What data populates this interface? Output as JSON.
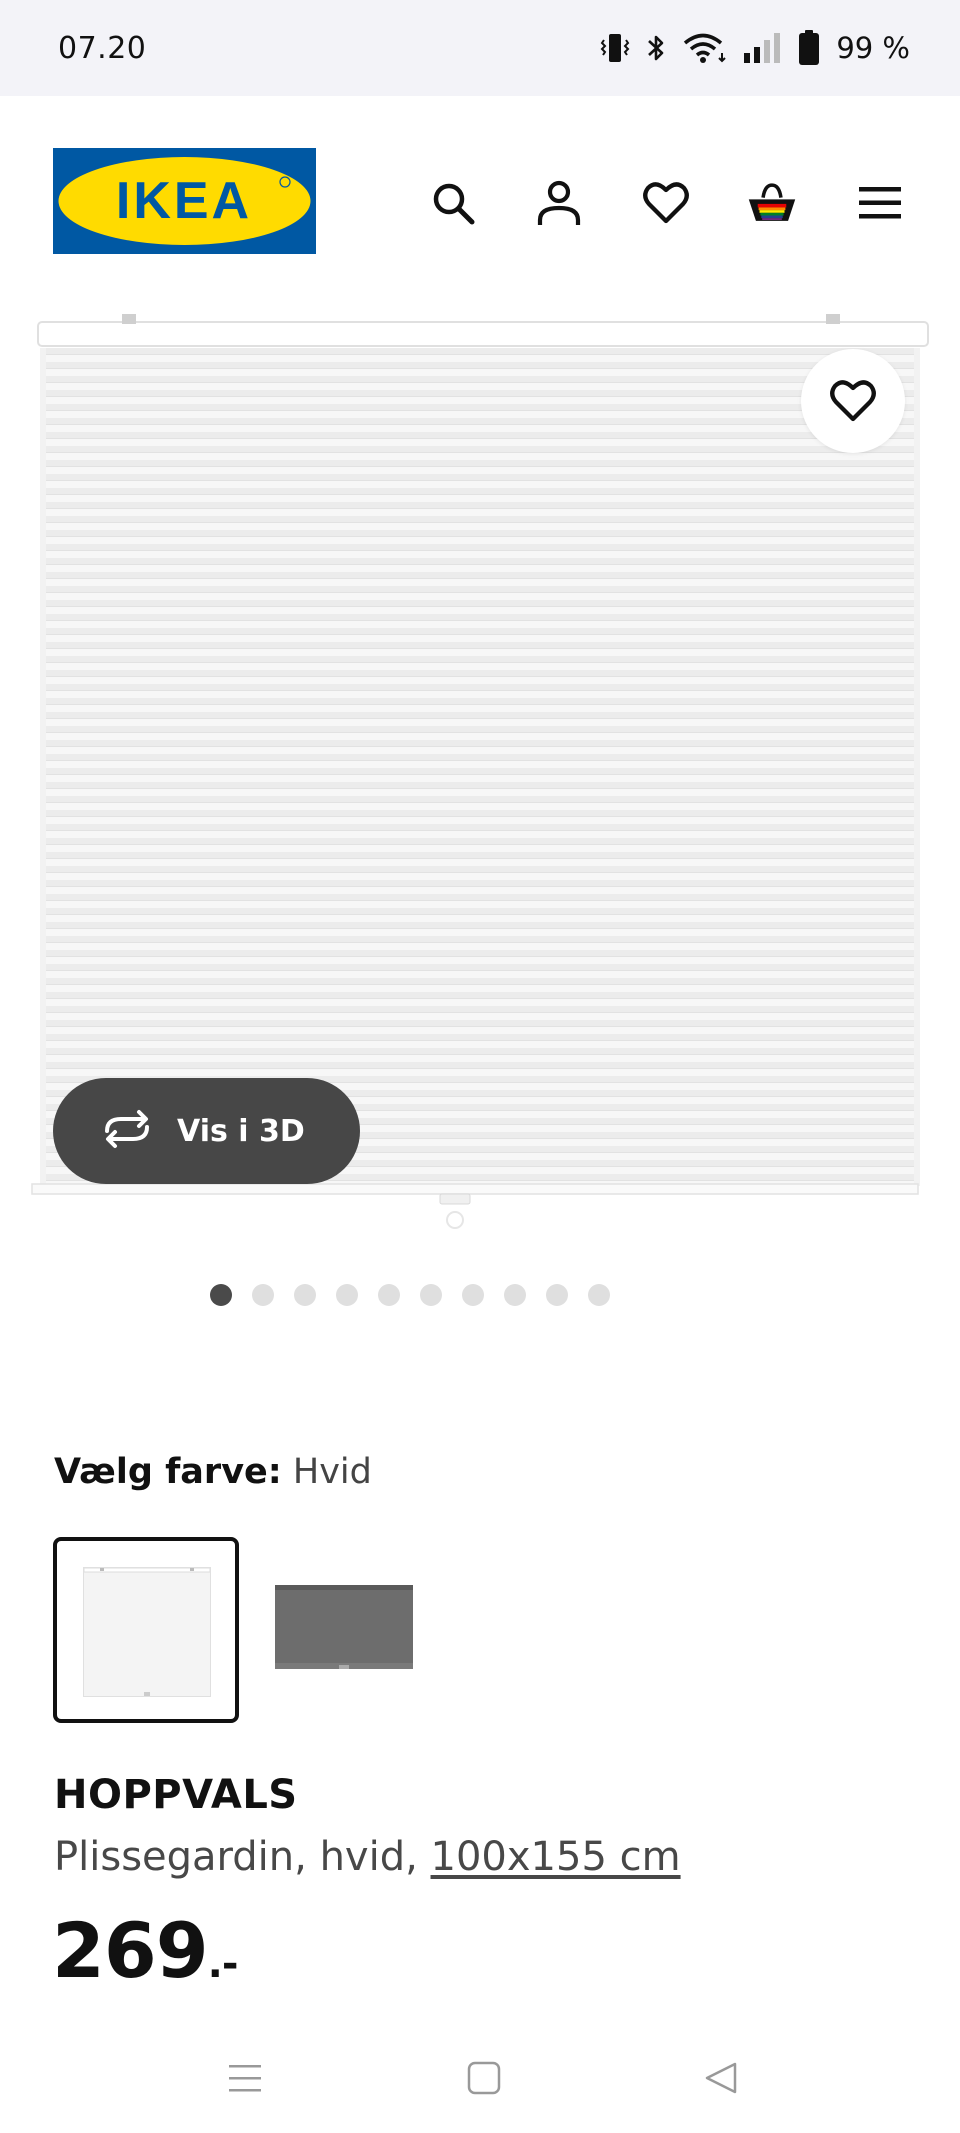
{
  "status_bar": {
    "time": "07.20",
    "battery": "99 %",
    "icons": [
      "vibrate-icon",
      "bluetooth-icon",
      "wifi-icon",
      "signal-icon",
      "battery-icon"
    ]
  },
  "header": {
    "logo_text": "IKEA",
    "icons": [
      "search-icon",
      "account-icon",
      "heart-icon",
      "basket-icon",
      "menu-icon"
    ]
  },
  "gallery": {
    "view_3d_label": "Vis i 3D",
    "dot_count": 10,
    "active_dot": 0
  },
  "color_selector": {
    "label": "Vælg farve:",
    "value": "Hvid",
    "options": [
      "Hvid",
      "Grå"
    ],
    "selected_index": 0
  },
  "product": {
    "name": "HOPPVALS",
    "description": "Plissegardin, hvid, ",
    "size": "100x155 cm",
    "price": "269",
    "price_suffix": ".-"
  },
  "colors": {
    "ikea_blue": "#0058a3",
    "ikea_yellow": "#ffdb00",
    "button_dark": "#474747"
  }
}
